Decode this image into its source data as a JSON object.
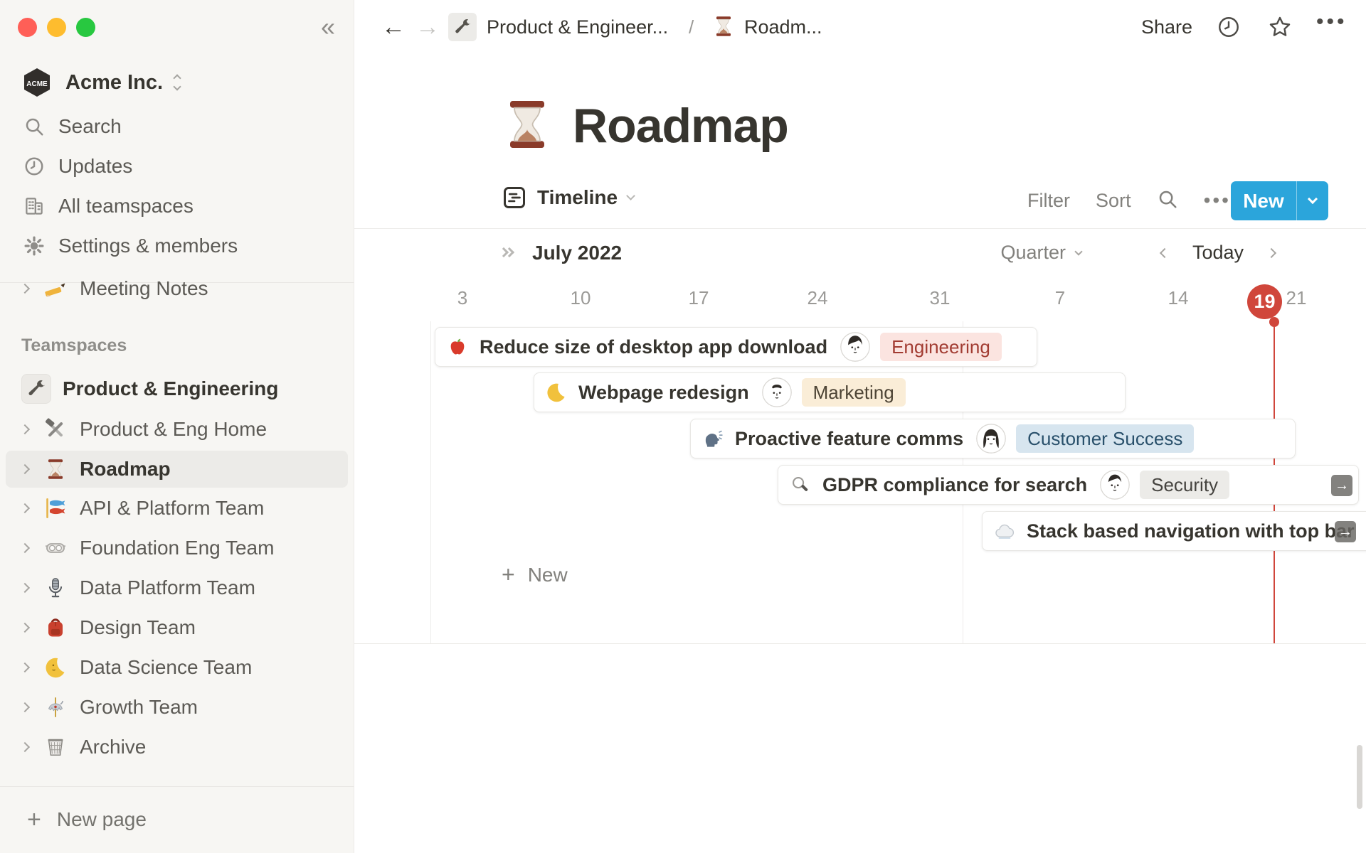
{
  "window": {
    "traffic_lights": [
      "close",
      "minimize",
      "maximize"
    ]
  },
  "sidebar": {
    "workspace_name": "Acme Inc.",
    "workspace_logo_text": "ACME",
    "menu": [
      {
        "label": "Search",
        "icon": "search-icon"
      },
      {
        "label": "Updates",
        "icon": "clock-icon"
      },
      {
        "label": "All teamspaces",
        "icon": "building-icon"
      },
      {
        "label": "Settings & members",
        "icon": "gear-icon"
      }
    ],
    "pages": [
      {
        "label": "Meeting Notes",
        "icon": "writing-hand-icon"
      }
    ],
    "section_header": "Teamspaces",
    "teamspaces": [
      {
        "label": "Product & Engineering",
        "icon": "wrench-icon"
      },
      {
        "label": "Product & Eng Home",
        "icon": "hammer-wrench-icon"
      },
      {
        "label": "Roadmap",
        "icon": "hourglass-icon",
        "selected": true
      },
      {
        "label": "API & Platform Team",
        "icon": "carp-streamer-icon"
      },
      {
        "label": "Foundation Eng Team",
        "icon": "goggles-icon"
      },
      {
        "label": "Data Platform Team",
        "icon": "microphone-icon"
      },
      {
        "label": "Design Team",
        "icon": "backpack-icon"
      },
      {
        "label": "Data Science Team",
        "icon": "crescent-moon-icon"
      },
      {
        "label": "Growth Team",
        "icon": "carousel-horse-icon"
      },
      {
        "label": "Archive",
        "icon": "wastebasket-icon"
      }
    ],
    "new_page_label": "New page"
  },
  "topbar": {
    "breadcrumb_1": "Product & Engineer...",
    "breadcrumb_separator": "/",
    "breadcrumb_2": "Roadm...",
    "share_label": "Share"
  },
  "page": {
    "title": "Roadmap",
    "title_icon": "hourglass-icon"
  },
  "controls": {
    "view_label": "Timeline",
    "filter_label": "Filter",
    "sort_label": "Sort",
    "more_label": "•••",
    "new_button_label": "New"
  },
  "timeline": {
    "month_label": "July 2022",
    "zoom_level": "Quarter",
    "today_label": "Today",
    "dates": [
      "3",
      "10",
      "17",
      "24",
      "31",
      "7",
      "14",
      "19",
      "21"
    ],
    "today_date": "19",
    "new_row_label": "New",
    "items": [
      {
        "title": "Reduce size of desktop app download",
        "icon": "apple-icon",
        "assignee": "man-avatar",
        "team_tag": "Engineering"
      },
      {
        "title": "Webpage redesign",
        "icon": "crescent-moon-icon",
        "assignee": "man-avatar",
        "team_tag": "Marketing"
      },
      {
        "title": "Proactive feature comms",
        "icon": "speaking-head-icon",
        "assignee": "woman-avatar",
        "team_tag": "Customer Success"
      },
      {
        "title": "GDPR compliance for search",
        "icon": "magnifier-icon",
        "assignee": "man-avatar",
        "team_tag": "Security"
      },
      {
        "title": "Stack based navigation with top bar",
        "icon": "cloud-icon"
      }
    ]
  },
  "colors": {
    "accent_blue": "#2BA5DB",
    "today_red": "#D0463B",
    "sidebar_bg": "#F7F6F3",
    "tag_engineering_bg": "#FBE4E0",
    "tag_engineering_text": "#A23C32",
    "tag_marketing_bg": "#FAEDD7",
    "tag_marketing_text": "#4D4435",
    "tag_customer_success_bg": "#D7E5EF",
    "tag_customer_success_text": "#29506B",
    "tag_security_bg": "#ECEBE8",
    "tag_security_text": "#45433F"
  }
}
